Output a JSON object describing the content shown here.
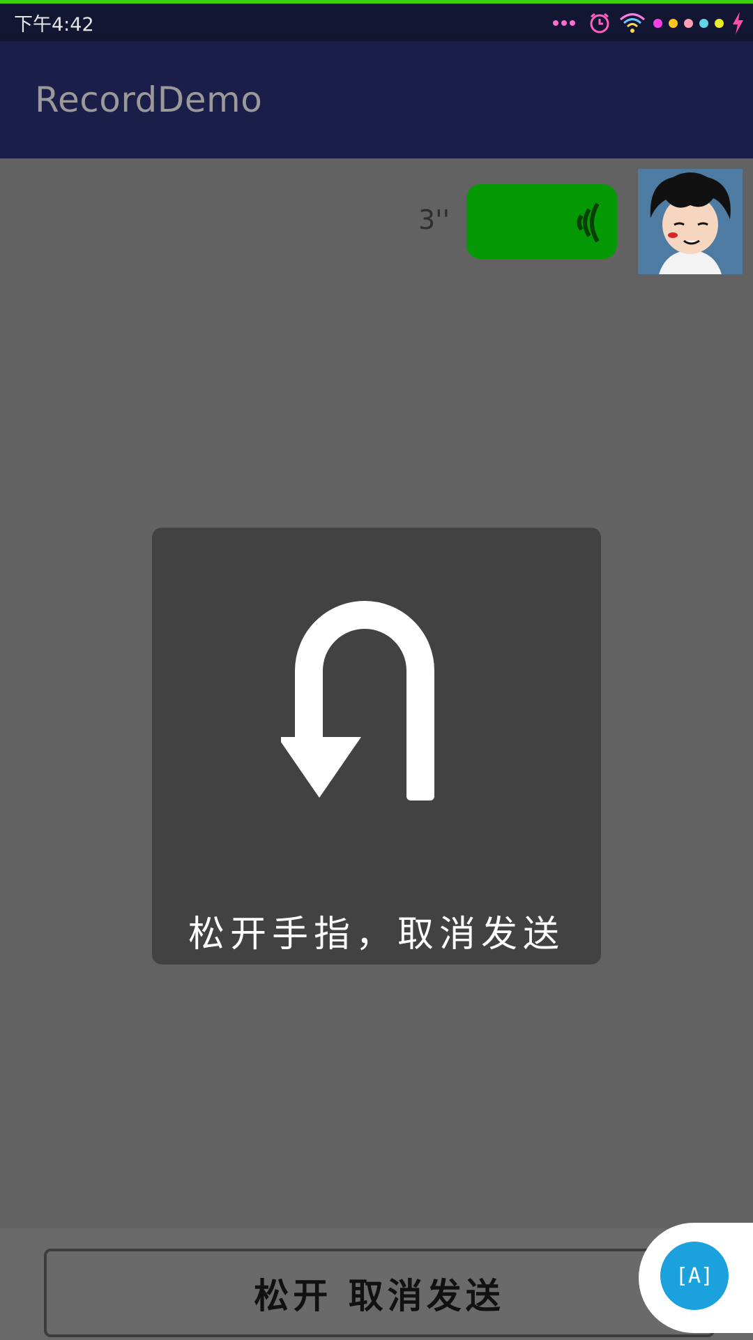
{
  "status_bar": {
    "time": "下午4:42",
    "icons": [
      "more-dots-icon",
      "alarm-icon",
      "wifi-icon",
      "notification-dots",
      "charging-icon"
    ]
  },
  "app_bar": {
    "title": "RecordDemo"
  },
  "message": {
    "duration": "3''",
    "bubble_color": "#059a05",
    "bubble_icon": "voice-wave-icon",
    "avatar": "user-avatar-cartoon"
  },
  "dialog": {
    "icon": "u-turn-back-icon",
    "text": "松开手指，取消发送"
  },
  "record_button": {
    "label": "松开 取消发送"
  },
  "floating_button": {
    "label": "[A]"
  },
  "colors": {
    "status_bar": "#131633",
    "app_bar": "#1a1e48",
    "top_line": "#3bd10f",
    "background": "#626262",
    "dialog": "#424242",
    "floating_button": "#1ba2dc"
  }
}
